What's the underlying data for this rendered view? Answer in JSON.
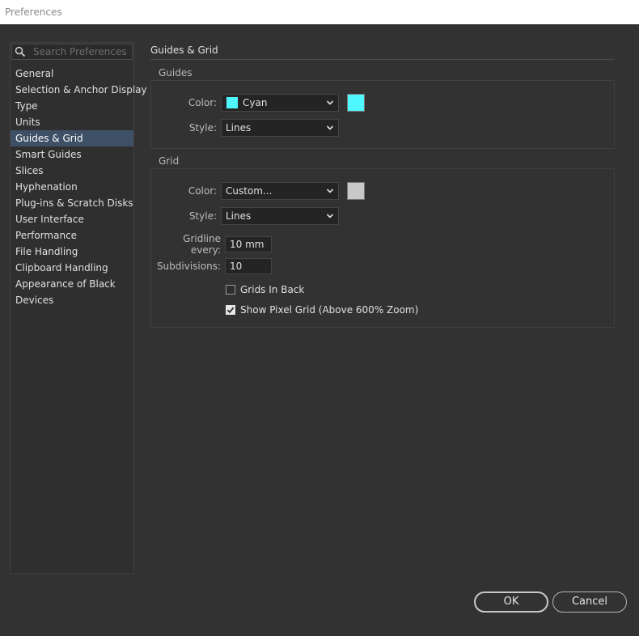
{
  "window": {
    "title": "Preferences"
  },
  "search": {
    "placeholder": "Search Preferences"
  },
  "nav": {
    "items": [
      "General",
      "Selection & Anchor Display",
      "Type",
      "Units",
      "Guides & Grid",
      "Smart Guides",
      "Slices",
      "Hyphenation",
      "Plug-ins & Scratch Disks",
      "User Interface",
      "Performance",
      "File Handling",
      "Clipboard Handling",
      "Appearance of Black",
      "Devices"
    ],
    "selected": "Guides & Grid"
  },
  "page": {
    "title": "Guides & Grid"
  },
  "guides": {
    "label": "Guides",
    "color_label": "Color:",
    "color_value": "Cyan",
    "color_hex": "#4ff7ff",
    "style_label": "Style:",
    "style_value": "Lines"
  },
  "grid": {
    "label": "Grid",
    "color_label": "Color:",
    "color_value": "Custom...",
    "color_hex": "#c8c8c8",
    "style_label": "Style:",
    "style_value": "Lines",
    "gridline_label": "Gridline every:",
    "gridline_value": "10 mm",
    "subdiv_label": "Subdivisions:",
    "subdiv_value": "10",
    "grids_in_back_label": "Grids In Back",
    "grids_in_back_checked": false,
    "pixel_grid_label": "Show Pixel Grid (Above 600% Zoom)",
    "pixel_grid_checked": true
  },
  "buttons": {
    "ok": "OK",
    "cancel": "Cancel"
  },
  "icons": {
    "search": "search-icon",
    "dropdown": "chevron-down-icon",
    "check": "checkmark-icon"
  }
}
